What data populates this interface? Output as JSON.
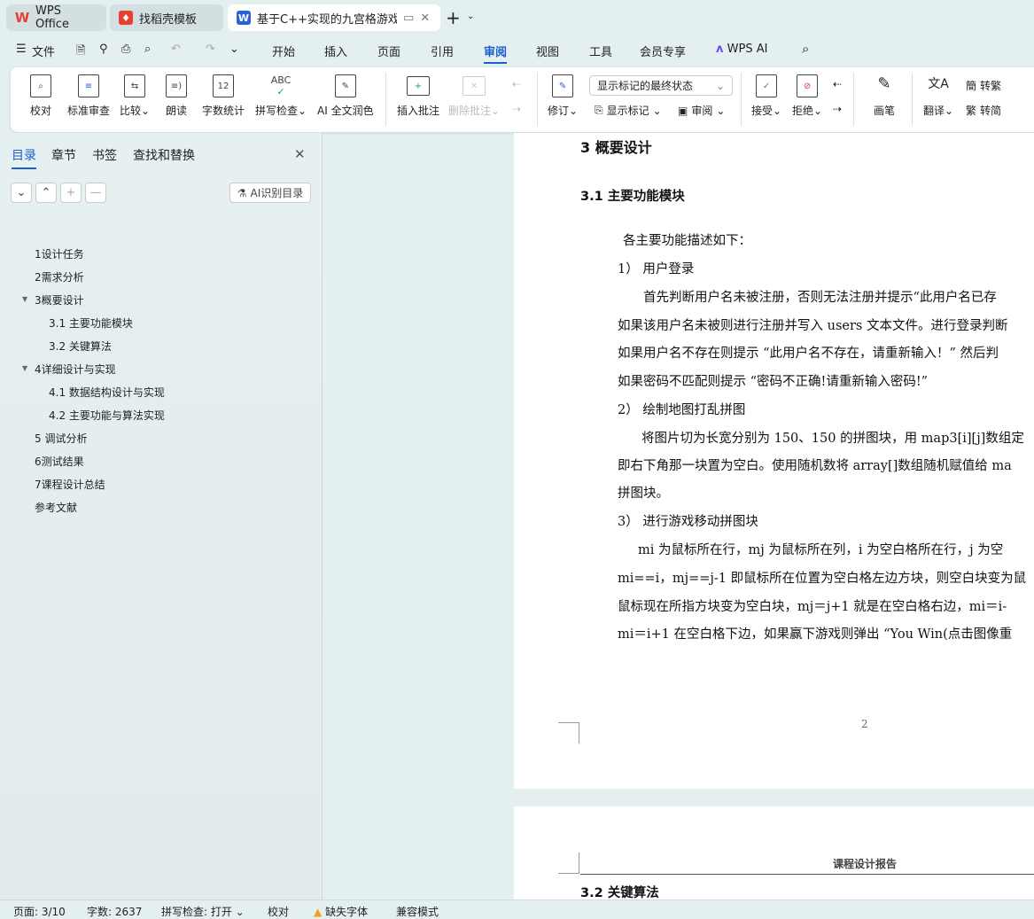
{
  "tabs": [
    {
      "label": "WPS Office",
      "icon": "wps-logo-icon"
    },
    {
      "label": "找稻壳模板",
      "icon": "docer-logo-icon"
    },
    {
      "label": "基于C++实现的九宫格游戏的",
      "icon": "word-doc-icon"
    }
  ],
  "menu": {
    "file": "文件",
    "items": [
      "开始",
      "插入",
      "页面",
      "引用",
      "审阅",
      "视图",
      "工具",
      "会员专享"
    ],
    "active": "审阅",
    "wps_ai": "WPS AI"
  },
  "ribbon": {
    "proofread": "校对",
    "standard_review": "标准审查",
    "compare": "比较",
    "read_aloud": "朗读",
    "word_count": "字数统计",
    "spell_check": "拼写检查",
    "ai_polish": "AI 全文润色",
    "insert_comment": "插入批注",
    "delete_comment": "删除批注",
    "track_changes": "修订",
    "markup_select": "显示标记的最终状态",
    "show_markup": "显示标记",
    "review_pane": "审阅",
    "accept": "接受",
    "reject": "拒绝",
    "pen": "画笔",
    "translate": "翻译",
    "to_traditional": "转繁",
    "to_simplified": "转简"
  },
  "sidebar": {
    "tabs": [
      "目录",
      "章节",
      "书签",
      "查找和替换"
    ],
    "active_tab": "目录",
    "ai_toc": "AI识别目录",
    "toc": [
      {
        "label": "1设计任务",
        "level": 1
      },
      {
        "label": "2需求分析",
        "level": 1
      },
      {
        "label": "3概要设计",
        "level": 1,
        "expanded": true
      },
      {
        "label": "3.1  主要功能模块",
        "level": 2
      },
      {
        "label": "3.2  关键算法",
        "level": 2
      },
      {
        "label": "4详细设计与实现",
        "level": 1,
        "expanded": true
      },
      {
        "label": "4.1  数据结构设计与实现",
        "level": 2
      },
      {
        "label": "4.2  主要功能与算法实现",
        "level": 2
      },
      {
        "label": "5  调试分析",
        "level": 1
      },
      {
        "label": "6测试结果",
        "level": 1
      },
      {
        "label": "7课程设计总结",
        "level": 1
      },
      {
        "label": "参考文献",
        "level": 1
      }
    ]
  },
  "document": {
    "h1": "3  概要设计",
    "h2": "3.1  主要功能模块",
    "lines": [
      "各主要功能描述如下：",
      "1）    用户登录",
      "首先判断用户名未被注册，否则无法注册并提示“此用户名已存",
      "如果该用户名未被则进行注册并写入 users 文本文件。进行登录判断",
      "如果用户名不存在则提示 “此用户名不存在，请重新输入！” 然后判",
      "如果密码不匹配则提示 “密码不正确!请重新输入密码!”",
      "2）    绘制地图打乱拼图",
      "将图片切为长宽分别为 150、150 的拼图块，用 map3[i][j]数组定",
      "即右下角那一块置为空白。使用随机数将 array[]数组随机赋值给 ma",
      "拼图块。",
      "3）    进行游戏移动拼图块",
      "mi 为鼠标所在行，mj 为鼠标所在列，i 为空白格所在行，j 为空",
      "mi==i，mj==j-1 即鼠标所在位置为空白格左边方块，则空白块变为鼠",
      "鼠标现在所指方块变为空白块，mj＝j+1 就是在空白格右边，mi＝i-",
      "mi＝i+1 在空白格下边，如果赢下游戏则弹出 “You Win(点击图像重"
    ],
    "page_number": "2",
    "header": "课程设计报告",
    "next_h2": "3.2  关键算法"
  },
  "status": {
    "page": "页面: 3/10",
    "words": "字数: 2637",
    "spell": "拼写检查: 打开",
    "proof": "校对",
    "missing_font": "缺失字体",
    "compat": "兼容模式"
  },
  "colors": {
    "accent": "#1a5fd0",
    "wps_red": "#e8402f",
    "warning": "#f0a020"
  }
}
